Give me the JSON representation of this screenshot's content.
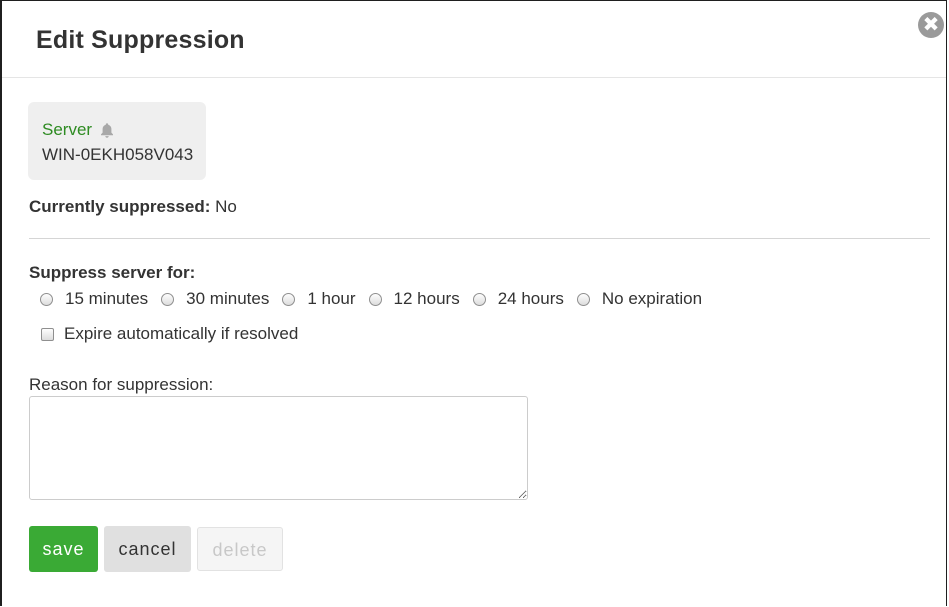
{
  "dialog": {
    "title": "Edit Suppression"
  },
  "server": {
    "type_label": "Server",
    "name": "WIN-0EKH058V043",
    "type_color": "#2e8b22"
  },
  "status": {
    "label": "Currently suppressed:",
    "value": "No"
  },
  "suppress": {
    "label": "Suppress server for:",
    "options": [
      "15 minutes",
      "30 minutes",
      "1 hour",
      "12 hours",
      "24 hours",
      "No expiration"
    ],
    "selected": null
  },
  "expire": {
    "label": "Expire automatically if resolved",
    "checked": false
  },
  "reason": {
    "label": "Reason for suppression:",
    "value": ""
  },
  "buttons": {
    "save": "save",
    "cancel": "cancel",
    "delete": "delete"
  },
  "colors": {
    "save_bg": "#3aaa35",
    "cancel_bg": "#e0e0e0",
    "delete_text": "#c8c8c8"
  },
  "icons": {
    "close": "close-circle-icon",
    "bell": "bell-icon"
  }
}
